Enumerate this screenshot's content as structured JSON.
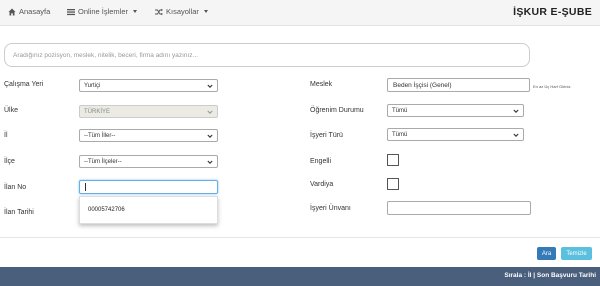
{
  "nav": {
    "home": "Anasayfa",
    "online": "Online İşlemler",
    "shortcuts": "Kısayollar",
    "brand": "İŞKUR E-ŞUBE"
  },
  "search": {
    "placeholder": "Aradığınız pozisyon, meslek, nitelik, beceri, firma adını yazınız..."
  },
  "form": {
    "calisma_yeri": {
      "label": "Çalışma Yeri",
      "value": "Yurtiçi"
    },
    "ulke": {
      "label": "Ülke",
      "value": "TÜRKİYE"
    },
    "il": {
      "label": "İl",
      "value": "--Tüm İller--"
    },
    "ilce": {
      "label": "İlçe",
      "value": "--Tüm İlçeler--"
    },
    "ilan_no": {
      "label": "İlan No",
      "value": ""
    },
    "ilan_tarihi": {
      "label": "İlan Tarihi"
    },
    "meslek": {
      "label": "Meslek",
      "value": "Beden İşçisi (Genel)",
      "hint": "En az Üç Harf Giriniz."
    },
    "ogrenim": {
      "label": "Öğrenim Durumu",
      "value": "Tümü"
    },
    "isyeri_turu": {
      "label": "İşyeri Türü",
      "value": "Tümü"
    },
    "engelli": {
      "label": "Engelli"
    },
    "vardiya": {
      "label": "Vardiya"
    },
    "isyeri_unvani": {
      "label": "İşyeri Ünvanı",
      "value": ""
    }
  },
  "autocomplete": {
    "suggestion": "00005742706"
  },
  "buttons": {
    "search": "Ara",
    "clear": "Temizle"
  },
  "footer": {
    "sort": "Sırala : İl | Son Başvuru Tarihi"
  }
}
